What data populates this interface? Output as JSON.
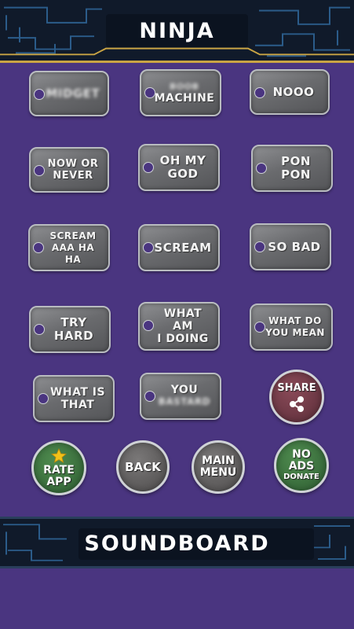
{
  "header": {
    "title": "NINJA"
  },
  "footer": {
    "title": "SOUNDBOARD"
  },
  "sounds": [
    {
      "label": "MIDGET",
      "blurred": true
    },
    {
      "label_top": "BOOB",
      "label": "MACHINE"
    },
    {
      "label": "NOOO"
    },
    {
      "label": "NOW OR\nNEVER"
    },
    {
      "label": "OH MY\nGOD"
    },
    {
      "label": "PON\nPON"
    },
    {
      "label": "SCREAM\nAAA HA HA"
    },
    {
      "label": "SCREAM"
    },
    {
      "label": "SO BAD"
    },
    {
      "label": "TRY\nHARD"
    },
    {
      "label": "WHAT AM\nI DOING"
    },
    {
      "label": "WHAT DO\nYOU MEAN"
    },
    {
      "label": "WHAT IS\nTHAT"
    },
    {
      "label": "YOU",
      "label_bottom": "BASTARD"
    }
  ],
  "actions": {
    "share": "SHARE",
    "rate": "RATE\nAPP",
    "back": "BACK",
    "main_menu": "MAIN\nMENU",
    "no_ads": "NO\nADS",
    "donate": "DONATE"
  },
  "colors": {
    "background": "#4a3580",
    "banner": "#101a2a",
    "banner_trim": "#c9a444",
    "tag_metal": "#6a6b6e",
    "green_button": "#3a6e3e",
    "gray_button": "#5e5c5c",
    "maroon_button": "#6e3a46",
    "star": "#f2c21a"
  }
}
